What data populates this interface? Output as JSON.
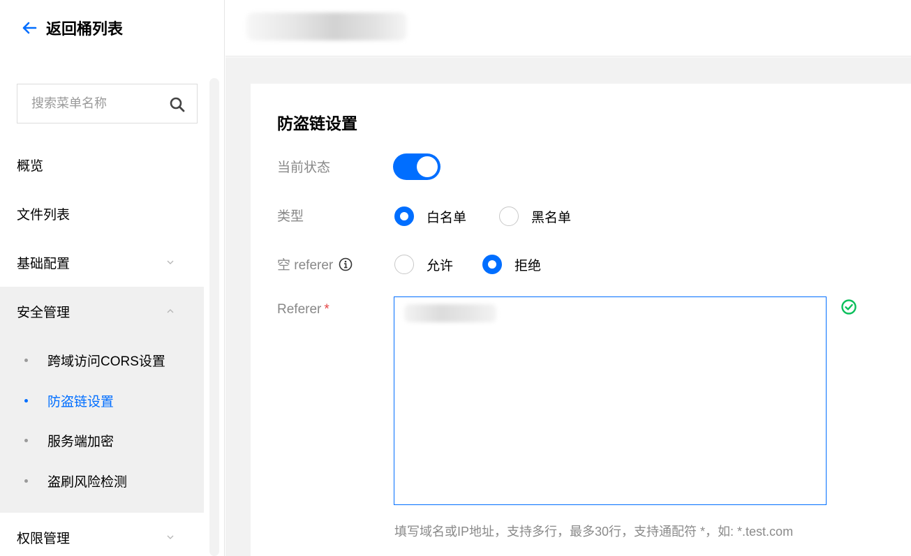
{
  "sidebar": {
    "back_label": "返回桶列表",
    "search_placeholder": "搜索菜单名称",
    "items": [
      {
        "label": "概览"
      },
      {
        "label": "文件列表"
      },
      {
        "label": "基础配置"
      },
      {
        "label": "安全管理"
      },
      {
        "label": "权限管理"
      }
    ],
    "security_sub_items": [
      {
        "label": "跨域访问CORS设置"
      },
      {
        "label": "防盗链设置",
        "active": true
      },
      {
        "label": "服务端加密"
      },
      {
        "label": "盗刷风险检测"
      }
    ]
  },
  "main": {
    "title": "防盗链设置",
    "status": {
      "label": "当前状态",
      "enabled": true
    },
    "type": {
      "label": "类型",
      "options": [
        "白名单",
        "黑名单"
      ],
      "selected": "白名单"
    },
    "empty_referer": {
      "label": "空 referer",
      "options": [
        "允许",
        "拒绝"
      ],
      "selected": "拒绝"
    },
    "referer": {
      "label": "Referer",
      "required_mark": "*",
      "hint": "填写域名或IP地址，支持多行，最多30行，支持通配符 *，如: *.test.com"
    }
  },
  "colors": {
    "accent": "#006eff",
    "success": "#0abf5b",
    "required": "#e54545"
  }
}
